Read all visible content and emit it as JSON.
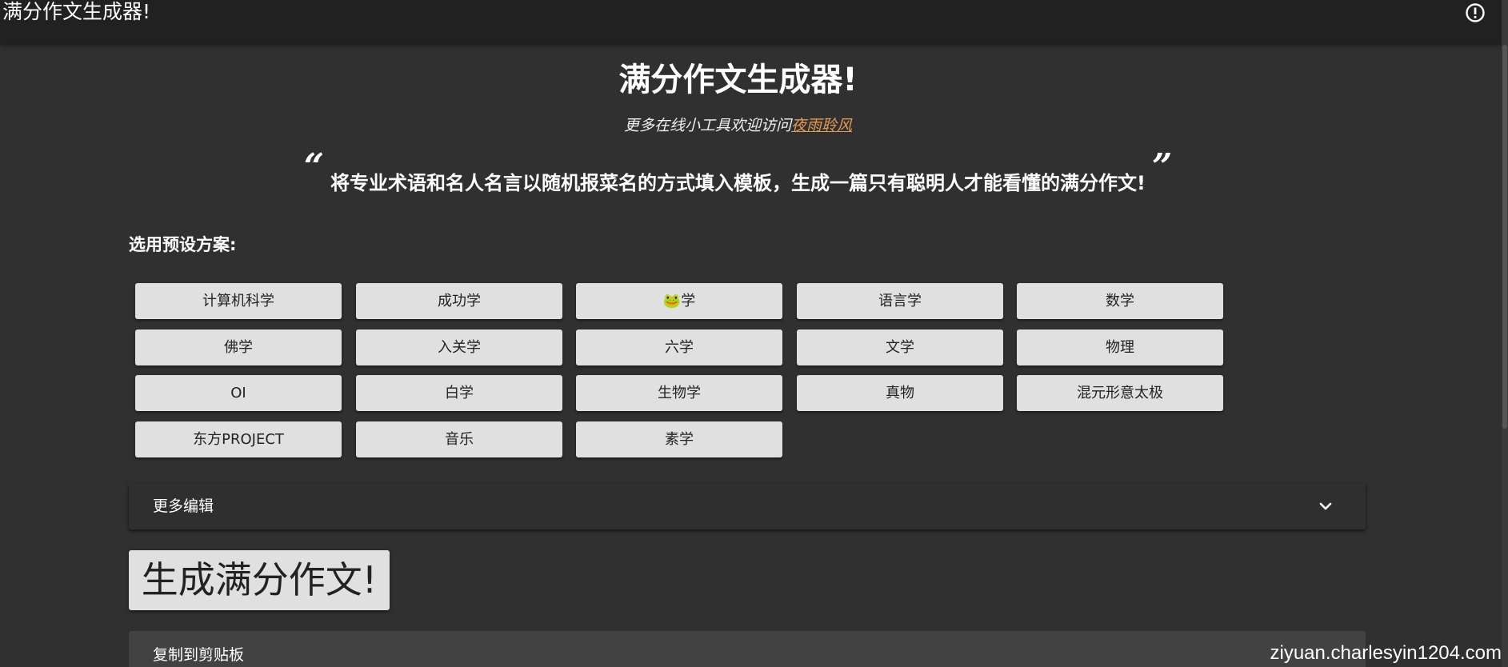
{
  "appbar": {
    "title": "满分作文生成器!",
    "info_icon": "info-icon"
  },
  "header": {
    "title": "满分作文生成器!",
    "subtitle_prefix": "更多在线小工具欢迎访问",
    "subtitle_link": "夜雨聆风"
  },
  "quote": {
    "open_mark": "“",
    "text": "将专业术语和名人名言以随机报菜名的方式填入模板，生成一篇只有聪明人才能看懂的满分作文!",
    "close_mark": "”"
  },
  "presets": {
    "label": "选用预设方案:",
    "items": [
      "计算机科学",
      "成功学",
      "🐸学",
      "语言学",
      "数学",
      "佛学",
      "入关学",
      "六学",
      "文学",
      "物理",
      "OI",
      "白学",
      "生物学",
      "真物",
      "混元形意太极",
      "东方PROJECT",
      "音乐",
      "素学"
    ]
  },
  "expander": {
    "label": "更多编辑",
    "icon": "chevron-down-icon"
  },
  "generate": {
    "label": "生成满分作文!"
  },
  "copy_panel": {
    "label": "复制到剪贴板"
  },
  "watermark": "ziyuan.charlesyin1204.com",
  "colors": {
    "background": "#303030",
    "appbar": "#212121",
    "button": "#e0e0e0",
    "link": "#e39a52"
  }
}
